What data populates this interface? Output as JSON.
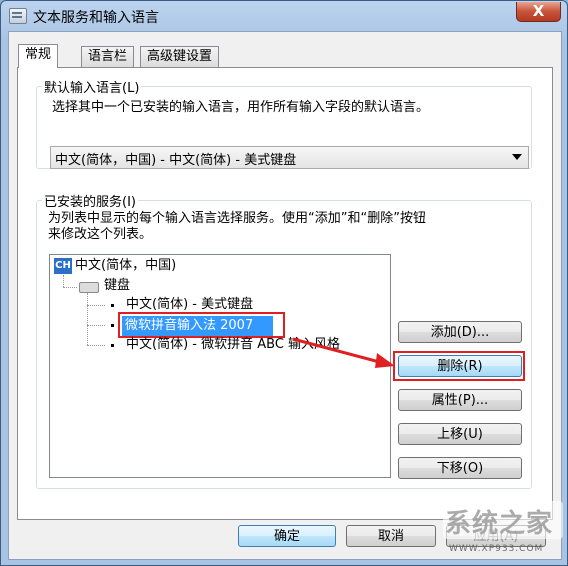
{
  "window": {
    "title": "文本服务和输入语言",
    "close_label": "X"
  },
  "tabs": [
    {
      "label": "常规",
      "active": true
    },
    {
      "label": "语言栏",
      "active": false
    },
    {
      "label": "高级键设置",
      "active": false
    }
  ],
  "default_language": {
    "legend": "默认输入语言(L)",
    "description": "选择其中一个已安装的输入语言，用作所有输入字段的默认语言。",
    "selected": "中文(简体，中国) - 中文(简体) - 美式键盘"
  },
  "installed_services": {
    "legend": "已安装的服务(I)",
    "description_line1": "为列表中显示的每个输入语言选择服务。使用“添加”和“删除”按钮",
    "description_line2": "来修改这个列表。",
    "tree": {
      "language": {
        "icon_text": "CH",
        "label": "中文(简体，中国)"
      },
      "category": "键盘",
      "items": [
        {
          "label": "中文(简体) - 美式键盘",
          "selected": false
        },
        {
          "label": "微软拼音输入法 2007",
          "selected": true
        },
        {
          "label": "中文(简体) - 微软拼音 ABC 输入风格",
          "selected": false
        }
      ]
    },
    "buttons": {
      "add": "添加(D)...",
      "remove": "删除(R)",
      "properties": "属性(P)...",
      "move_up": "上移(U)",
      "move_down": "下移(O)"
    }
  },
  "footer": {
    "ok": "确定",
    "cancel": "取消",
    "apply": "应用(A)"
  },
  "watermark": {
    "line1": "系统之家",
    "line2": "WWW.XP933.COM"
  },
  "colors": {
    "selection": "#3399ff",
    "annotation": "#e02020",
    "title_bar": "#a9c4e3"
  }
}
